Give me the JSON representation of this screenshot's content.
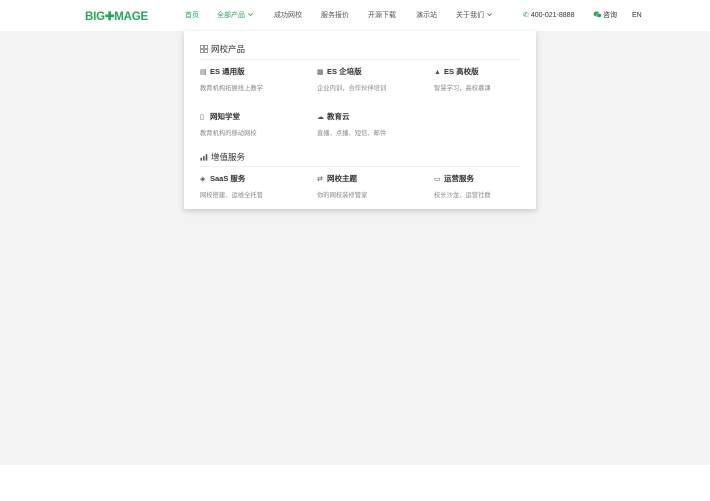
{
  "header": {
    "logo": {
      "left": "BIG",
      "mark": "✚",
      "right": "MAGE"
    },
    "nav": [
      {
        "label": "首页",
        "active": true
      },
      {
        "label": "全部产品",
        "active": true,
        "has_dropdown": true
      },
      {
        "label": "成功网校",
        "active": false
      },
      {
        "label": "服务报价",
        "active": false
      },
      {
        "label": "开源下载",
        "active": false
      },
      {
        "label": "演示站",
        "active": false
      },
      {
        "label": "关于我们",
        "active": false,
        "has_dropdown": true
      }
    ],
    "phone": "400-021-8888",
    "consult": "咨询",
    "lang": "EN"
  },
  "dropdown": {
    "sections": [
      {
        "title": "网校产品",
        "icon": "grid-icon",
        "items": [
          {
            "title": "ES 通用版",
            "desc": "教育机构拓展线上教学",
            "icon": "stack-icon"
          },
          {
            "title": "ES 企培版",
            "desc": "企业内训，合作伙伴培训",
            "icon": "building-icon"
          },
          {
            "title": "ES 高校版",
            "desc": "智慧学习，高校慕课",
            "icon": "graduation-cap-icon"
          },
          {
            "title": "网知学堂",
            "desc": "教育机构的移动网校",
            "icon": "mobile-icon"
          },
          {
            "title": "教育云",
            "desc": "直播、点播、短信、邮件",
            "icon": "cloud-icon"
          }
        ]
      },
      {
        "title": "增值服务",
        "icon": "chart-icon",
        "items": [
          {
            "title": "SaaS 服务",
            "desc": "网校搭建、运维全托管",
            "icon": "layers-icon"
          },
          {
            "title": "网校主题",
            "desc": "你的网校装修管家",
            "icon": "shuffle-icon"
          },
          {
            "title": "运营服务",
            "desc": "校长沙龙、运营社群",
            "icon": "monitor-icon"
          }
        ]
      }
    ]
  },
  "colors": {
    "accent": "#2aa55a",
    "page_bg": "#f3f3f3",
    "panel_bg": "#ffffff"
  }
}
